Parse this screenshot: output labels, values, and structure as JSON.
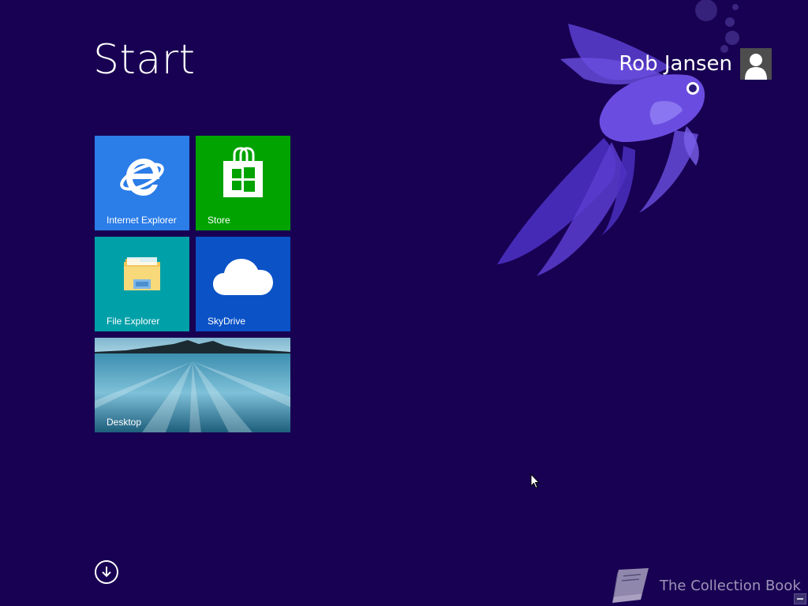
{
  "screen": {
    "title": "Start",
    "background_color": "#180052"
  },
  "user": {
    "name": "Rob Jansen"
  },
  "tiles": [
    {
      "label": "Internet Explorer",
      "color": "#2b7de8",
      "icon": "internet-explorer-icon"
    },
    {
      "label": "Store",
      "color": "#00a300",
      "icon": "store-icon"
    },
    {
      "label": "File Explorer",
      "color": "#00a0a8",
      "icon": "folder-icon"
    },
    {
      "label": "SkyDrive",
      "color": "#0b52c6",
      "icon": "cloud-icon"
    },
    {
      "label": "Desktop",
      "color": "#1f6b8a",
      "icon": "desktop-wallpaper"
    }
  ],
  "apps_button": {
    "icon": "arrow-down-circle-icon"
  },
  "watermark": {
    "text": "The Collection Book",
    "icon": "book-icon"
  }
}
